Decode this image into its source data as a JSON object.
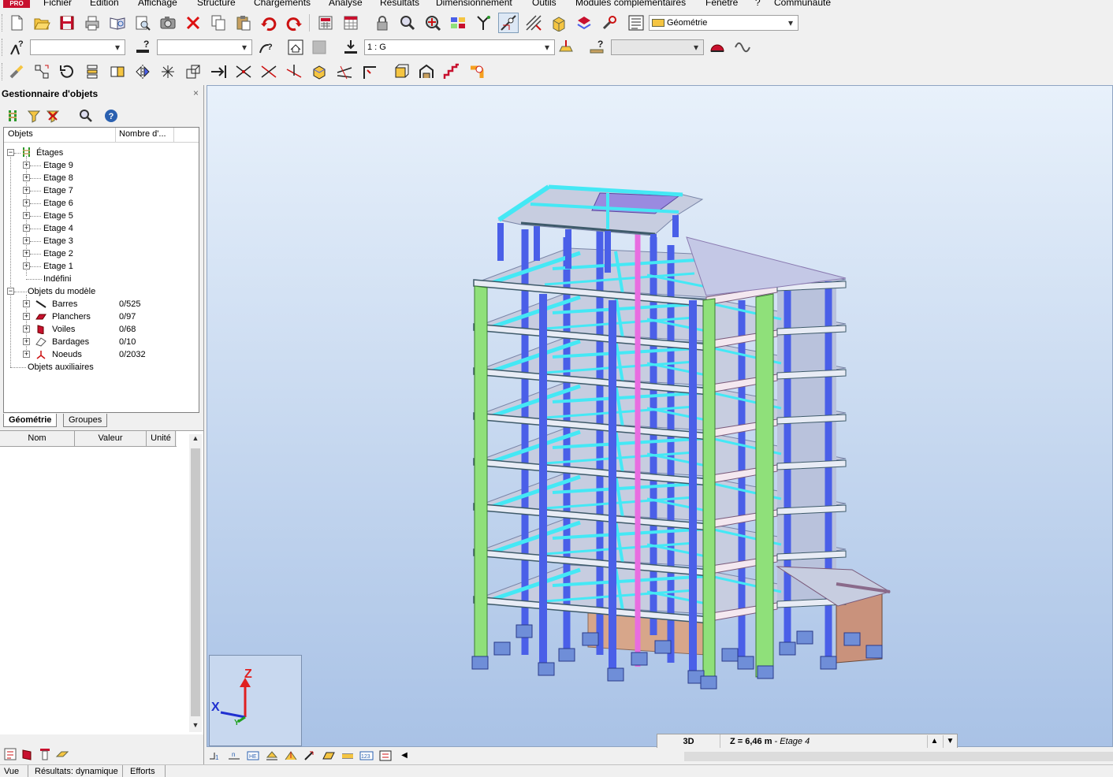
{
  "menubar": {
    "logo": "PRO",
    "items": [
      "Fichier",
      "Edition",
      "Affichage",
      "Structure",
      "Chargements",
      "Analyse",
      "Résultats",
      "Dimensionnement",
      "Outils",
      "Modules complémentaires",
      "Fenêtre",
      "?",
      "Communauté"
    ]
  },
  "toolbar1": {
    "layout_combo": "Géométrie",
    "icons": [
      "new-file-icon",
      "open-folder-icon",
      "save-icon",
      "print-icon",
      "print-preview-icon",
      "screen-capture-preview-icon",
      "camera-icon",
      "delete-icon",
      "copy-icon",
      "paste-icon",
      "undo-icon",
      "redo-icon",
      "calculator-icon",
      "tables-icon",
      "lock-icon",
      "zoom-icon",
      "zoom-window-icon",
      "display-icon",
      "tree-structure-icon",
      "section-icon",
      "geometry-icon",
      "structure-3d-icon",
      "groups-icon",
      "settings-icon",
      "layout-icon"
    ]
  },
  "toolbar2": {
    "node_combo": "",
    "bar_combo": "",
    "load_case_combo": "1 : G",
    "disabled_combo": ""
  },
  "object_manager": {
    "title": "Gestionnaire d'objets",
    "close": "×",
    "columns": {
      "objects": "Objets",
      "count": "Nombre d'..."
    },
    "root_etages": "Étages",
    "etages": [
      "Etage 9",
      "Etage 8",
      "Etage 7",
      "Etage 6",
      "Etage 5",
      "Etage 4",
      "Etage 3",
      "Etage 2",
      "Etage 1"
    ],
    "indefini": "Indéfini",
    "root_model": "Objets du modèle",
    "model_items": [
      {
        "label": "Barres",
        "count": "0/525"
      },
      {
        "label": "Planchers",
        "count": "0/97"
      },
      {
        "label": "Voiles",
        "count": "0/68"
      },
      {
        "label": "Bardages",
        "count": "0/10"
      },
      {
        "label": "Noeuds",
        "count": "0/2032"
      }
    ],
    "auxiliaires": "Objets auxiliaires",
    "tabs": [
      "Géométrie",
      "Groupes"
    ]
  },
  "properties": {
    "columns": {
      "name": "Nom",
      "value": "Valeur",
      "unit": "Unité"
    }
  },
  "viewport": {
    "axis_z": "Z",
    "axis_x": "X",
    "axis_y": "Y",
    "view_mode": "3D",
    "z_label": "Z = 6,46 m",
    "z_sep": " - ",
    "z_level": "Etage 4"
  },
  "statusbar": {
    "vue": "Vue",
    "results": "Résultats: dynamique",
    "efforts": "Efforts"
  },
  "colors": {
    "column_blue": "#4a5fe8",
    "wall_green": "#8fe07a",
    "beam_cyan": "#44e8f5",
    "slab": "#c7cde0",
    "pink_column": "#e86de0",
    "foundation": "#6f8ed8"
  }
}
